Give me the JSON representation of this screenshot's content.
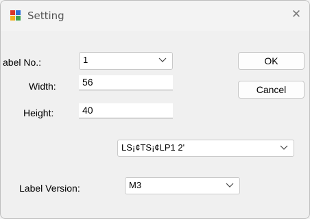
{
  "window": {
    "title": "Setting",
    "icon": "windows-form-icon"
  },
  "form": {
    "label_no": {
      "label": "abel No.:",
      "value": "1"
    },
    "width": {
      "label": "Width:",
      "value": "56"
    },
    "height": {
      "label": "Height:",
      "value": "40"
    },
    "printer": {
      "value": "LS¡¢TS¡¢LP1   2'"
    },
    "label_version": {
      "label": "Label Version:",
      "value": "M3"
    }
  },
  "buttons": {
    "ok": "OK",
    "cancel": "Cancel"
  }
}
